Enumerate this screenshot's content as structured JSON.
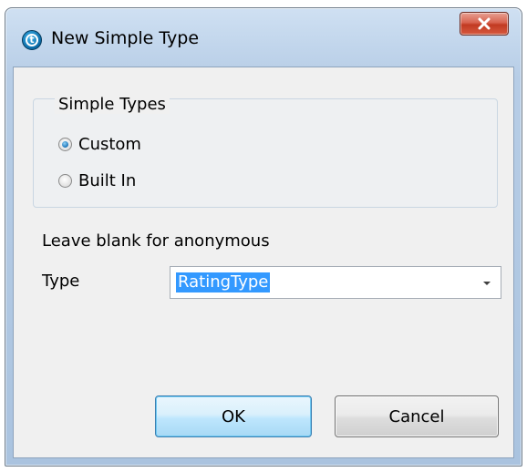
{
  "window": {
    "title": "New Simple Type",
    "icon": "talend-app-icon",
    "close_icon": "close-icon"
  },
  "group": {
    "legend": "Simple Types",
    "options": [
      {
        "label": "Custom",
        "checked": true
      },
      {
        "label": "Built In",
        "checked": false
      }
    ]
  },
  "hint": "Leave blank for anonymous",
  "type_field": {
    "label": "Type",
    "value": "RatingType",
    "arrow_icon": "chevron-down-icon"
  },
  "buttons": {
    "ok_label": "OK",
    "cancel_label": "Cancel"
  },
  "colors": {
    "selection": "#3399ff",
    "close_button": "#c23a22"
  }
}
